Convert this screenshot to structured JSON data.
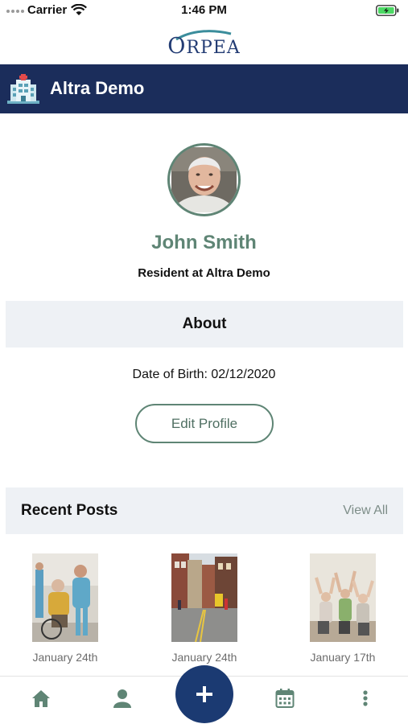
{
  "status_bar": {
    "carrier": "Carrier",
    "time": "1:46 PM"
  },
  "logo": {
    "text_first": "O",
    "text_rest": "RPEA"
  },
  "header": {
    "title": "Altra Demo",
    "icon": "hospital-icon"
  },
  "profile": {
    "name": "John Smith",
    "subtitle": "Resident at Altra Demo"
  },
  "about": {
    "title": "About",
    "dob": "Date of Birth: 02/12/2020",
    "edit_label": "Edit Profile"
  },
  "recent_posts": {
    "title": "Recent Posts",
    "view_all": "View All",
    "items": [
      {
        "date": "January 24th",
        "image": "caregiver-with-wheelchair-resident"
      },
      {
        "date": "January 24th",
        "image": "town-street-photo"
      },
      {
        "date": "January 17th",
        "image": "seniors-exercise-class"
      }
    ]
  },
  "tab_bar": {
    "items": [
      "home-icon",
      "profile-icon",
      "add-icon",
      "calendar-icon",
      "more-icon"
    ]
  },
  "colors": {
    "header_bg": "#1b2d5b",
    "accent_green": "#5f8575",
    "fab_bg": "#1b3a72",
    "section_bg": "#eef1f5"
  }
}
